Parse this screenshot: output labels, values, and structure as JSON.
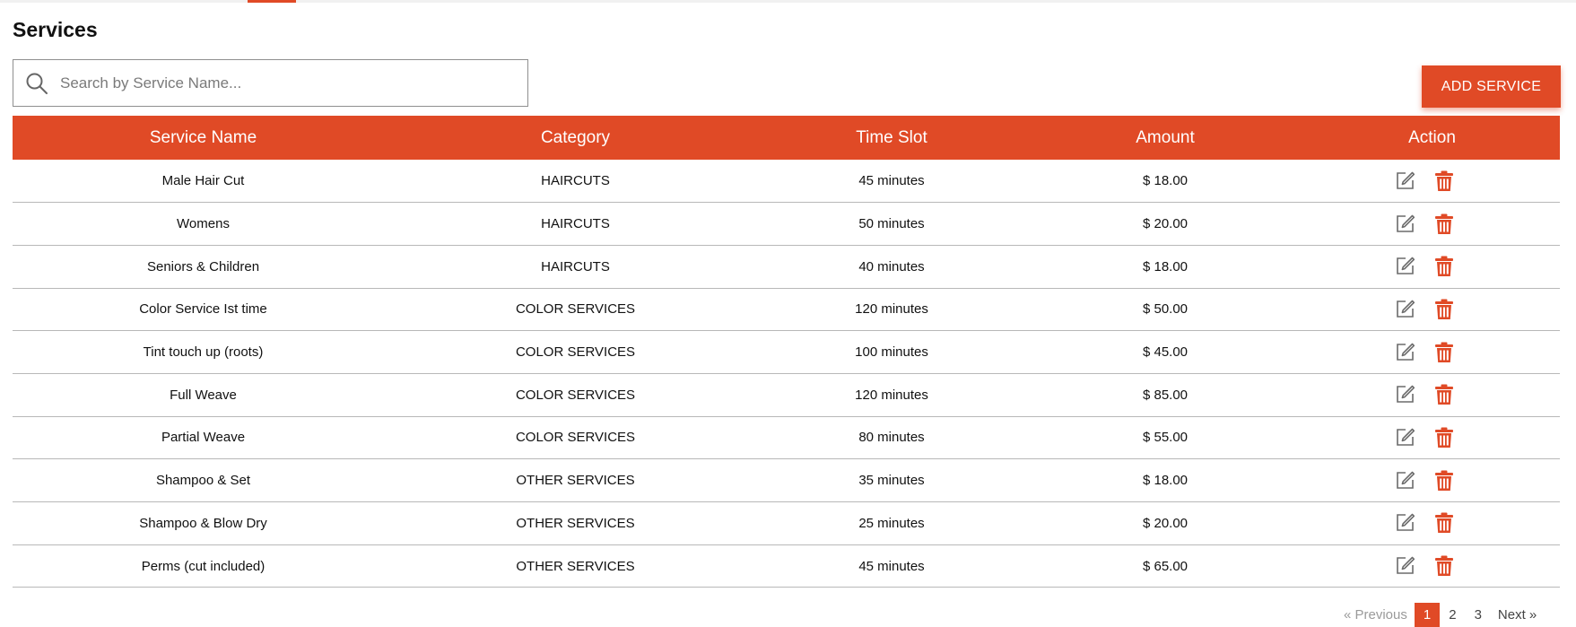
{
  "page": {
    "title": "Services"
  },
  "search": {
    "placeholder": "Search by Service Name...",
    "value": ""
  },
  "toolbar": {
    "add_label": "ADD SERVICE"
  },
  "table": {
    "headers": [
      "Service Name",
      "Category",
      "Time Slot",
      "Amount",
      "Action"
    ],
    "rows": [
      {
        "name": "Male Hair Cut",
        "category": "HAIRCUTS",
        "time": "45 minutes",
        "amount": "$ 18.00"
      },
      {
        "name": "Womens",
        "category": "HAIRCUTS",
        "time": "50 minutes",
        "amount": "$ 20.00"
      },
      {
        "name": "Seniors & Children",
        "category": "HAIRCUTS",
        "time": "40 minutes",
        "amount": "$ 18.00"
      },
      {
        "name": "Color Service Ist time",
        "category": "COLOR SERVICES",
        "time": "120 minutes",
        "amount": "$ 50.00"
      },
      {
        "name": "Tint touch up (roots)",
        "category": "COLOR SERVICES",
        "time": "100 minutes",
        "amount": "$ 45.00"
      },
      {
        "name": "Full Weave",
        "category": "COLOR SERVICES",
        "time": "120 minutes",
        "amount": "$ 85.00"
      },
      {
        "name": "Partial Weave",
        "category": "COLOR SERVICES",
        "time": "80 minutes",
        "amount": "$ 55.00"
      },
      {
        "name": "Shampoo & Set",
        "category": "OTHER SERVICES",
        "time": "35 minutes",
        "amount": "$ 18.00"
      },
      {
        "name": "Shampoo & Blow Dry",
        "category": "OTHER SERVICES",
        "time": "25 minutes",
        "amount": "$ 20.00"
      },
      {
        "name": "Perms (cut included)",
        "category": "OTHER SERVICES",
        "time": "45 minutes",
        "amount": "$ 65.00"
      }
    ]
  },
  "pagination": {
    "previous": "« Previous",
    "pages": [
      "1",
      "2",
      "3"
    ],
    "current": "1",
    "next": "Next »"
  },
  "icons": {
    "search": "search-icon",
    "edit": "edit-icon",
    "delete": "trash-icon"
  },
  "colors": {
    "accent": "#e04a26",
    "row_border": "#b8b8b8",
    "edit_icon": "#6b6b6b"
  }
}
